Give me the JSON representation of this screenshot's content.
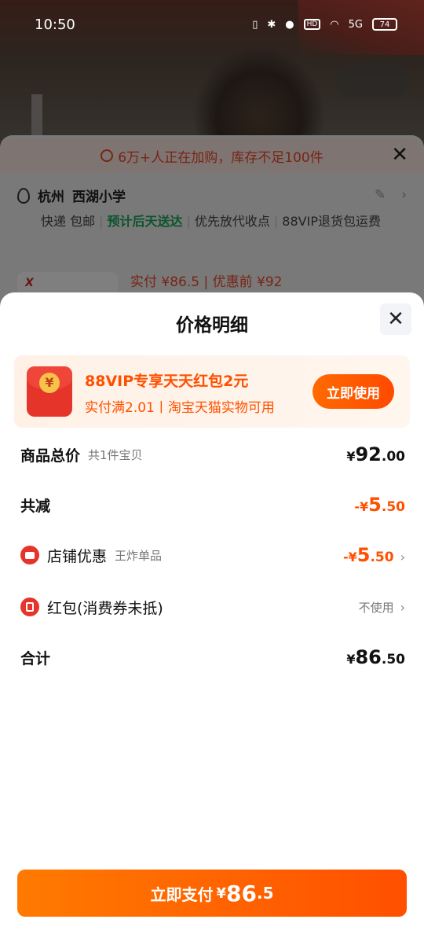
{
  "status_bar": {
    "time": "10:50",
    "net_badge": "HD",
    "signal": "5G",
    "battery": "74"
  },
  "background": {
    "notice": "6万+人正在加购，库存不足100件",
    "address": {
      "city": "杭州",
      "place": "西湖小学"
    },
    "delivery_tags": [
      "快递 包邮",
      "预计后天送达",
      "优先放代收点",
      "88VIP退货包运费"
    ],
    "product_price_text": "实付 ¥86.5 | 优惠前 ¥92"
  },
  "sheet": {
    "title": "价格明细",
    "vip_banner": {
      "title": "88VIP专享天天红包2元",
      "subtitle": "实付满2.01丨淘宝天猫实物可用",
      "button": "立即使用",
      "icon_symbol": "¥"
    },
    "total": {
      "label": "商品总价",
      "sub": "共1件宝贝",
      "currency": "¥",
      "int": "92",
      "dec": ".00"
    },
    "reduce": {
      "label": "共减",
      "prefix": "-¥",
      "int": "5",
      "dec": ".50"
    },
    "shop_discount": {
      "label": "店铺优惠",
      "sub": "王炸单品",
      "prefix": "-¥",
      "int": "5",
      "dec": ".50"
    },
    "red_packet": {
      "label": "红包(消费券未抵)",
      "value": "不使用"
    },
    "sum": {
      "label": "合计",
      "currency": "¥",
      "int": "86",
      "dec": ".50"
    },
    "pay_button": {
      "text": "立即支付",
      "currency": "¥",
      "int": "86",
      "dec": ".5"
    }
  },
  "colors": {
    "accent": "#ff5000",
    "red": "#e5352b",
    "green": "#17a85b"
  }
}
